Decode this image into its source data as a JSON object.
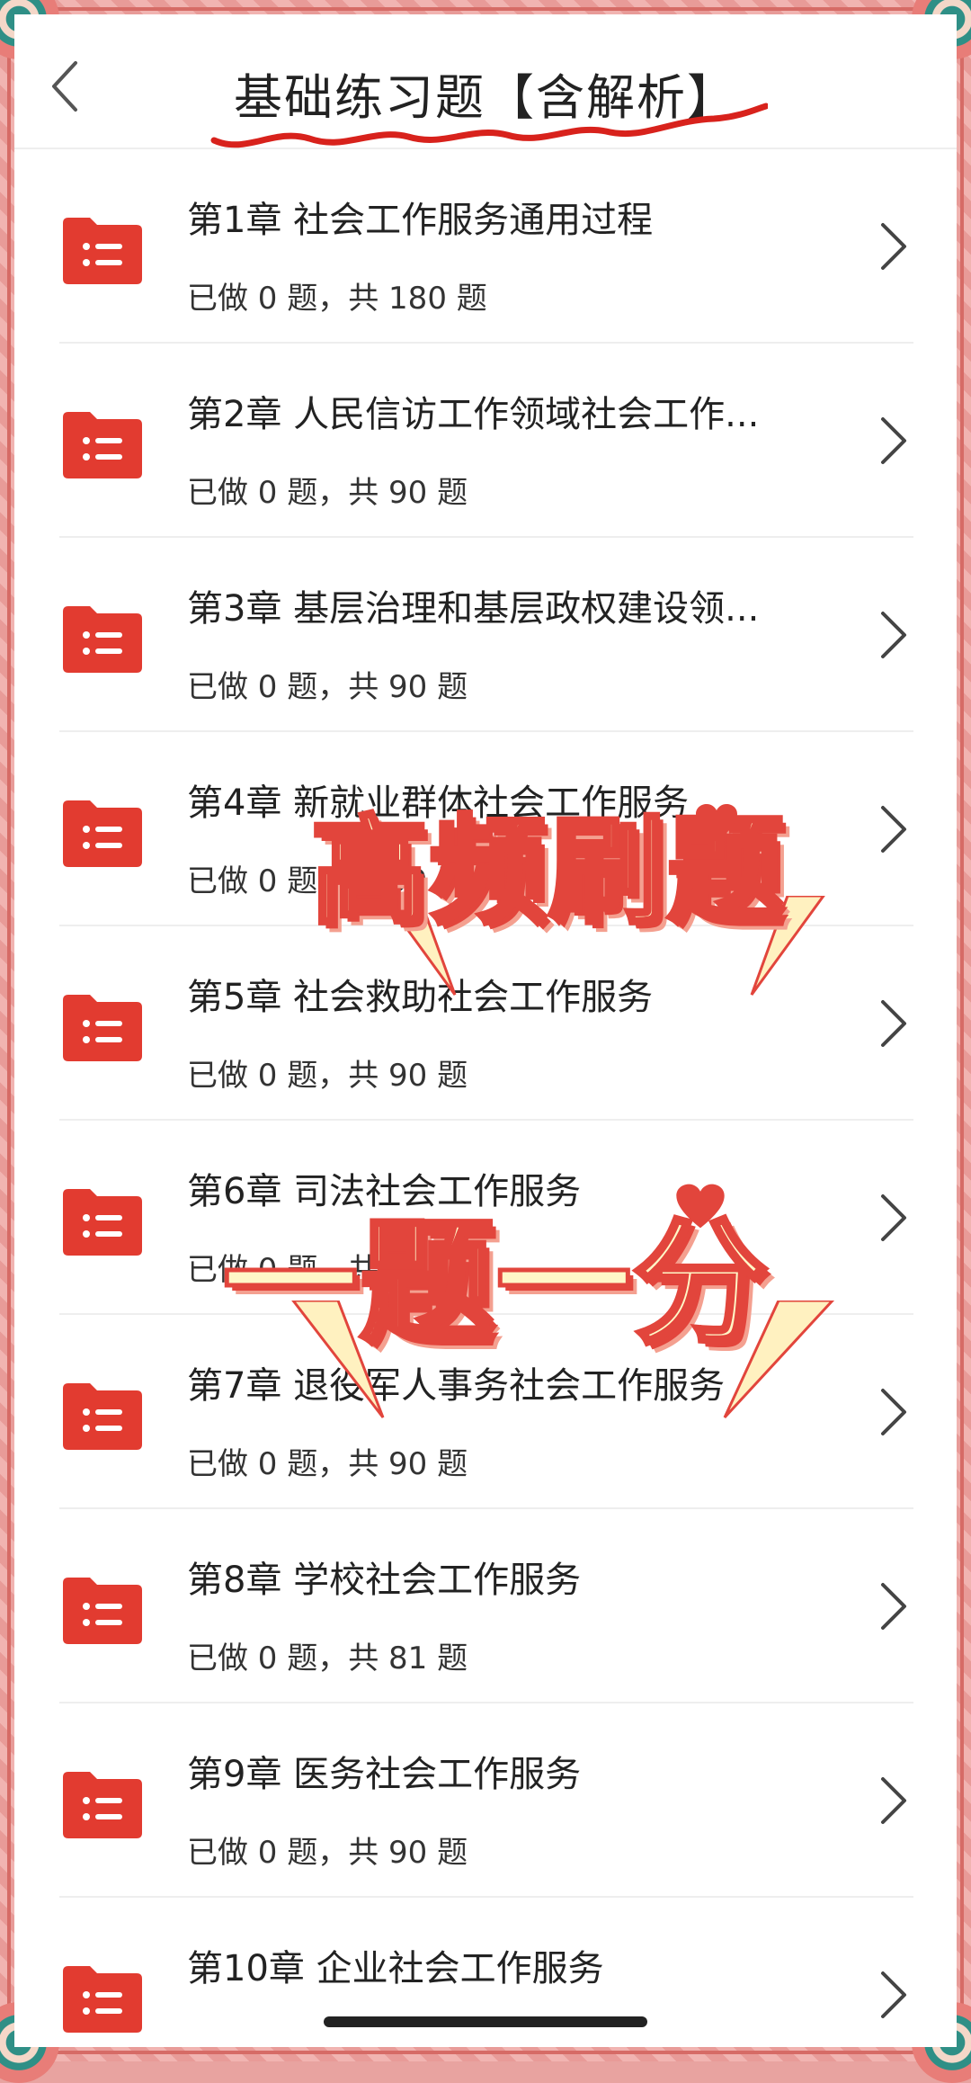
{
  "header": {
    "title": "基础练习题【含解析】"
  },
  "chapters": [
    {
      "title": "第1章 社会工作服务通用过程",
      "progress": "已做 0 题，共 180 题"
    },
    {
      "title": "第2章 人民信访工作领域社会工作...",
      "progress": "已做 0 题，共 90 题"
    },
    {
      "title": "第3章 基层治理和基层政权建设领...",
      "progress": "已做 0 题，共 90 题"
    },
    {
      "title": "第4章 新就业群体社会工作服务",
      "progress": "已做 0 题，共 90 题"
    },
    {
      "title": "第5章 社会救助社会工作服务",
      "progress": "已做 0 题，共 90 题"
    },
    {
      "title": "第6章 司法社会工作服务",
      "progress": "已做 0 题，共 90 题"
    },
    {
      "title": "第7章 退役军人事务社会工作服务",
      "progress": "已做 0 题，共 90 题"
    },
    {
      "title": "第8章 学校社会工作服务",
      "progress": "已做 0 题，共 81 题"
    },
    {
      "title": "第9章 医务社会工作服务",
      "progress": "已做 0 题，共 90 题"
    },
    {
      "title": "第10章 企业社会工作服务",
      "progress": ""
    }
  ],
  "overlay": {
    "line1": "高频刷题",
    "line2": "一题一分"
  },
  "colors": {
    "accent": "#e2453c",
    "frame": "#e89b98"
  },
  "icons": {
    "back": "chevron-left-icon",
    "folder": "folder-list-icon",
    "row_arrow": "chevron-right-icon"
  }
}
